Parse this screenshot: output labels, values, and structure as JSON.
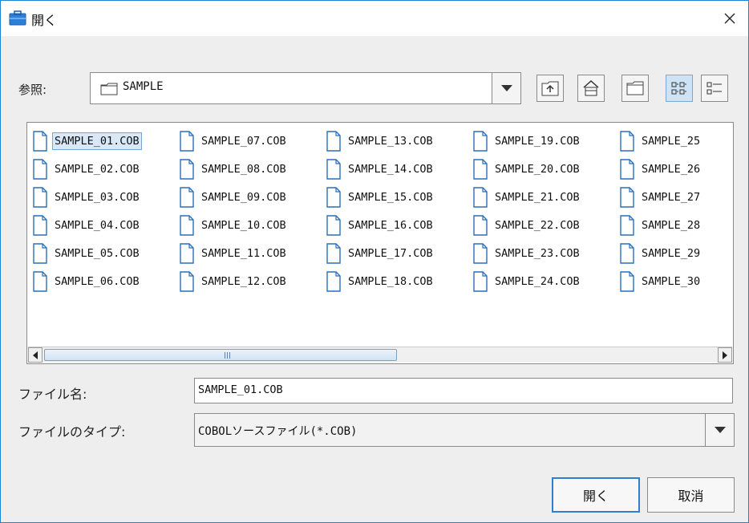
{
  "window": {
    "title": "開く",
    "close_glyph": "✕"
  },
  "lookin": {
    "label": "参照:",
    "value": "SAMPLE"
  },
  "toolbar": {
    "buttons": [
      {
        "icon": "up-one-level-icon"
      },
      {
        "icon": "home-icon"
      },
      {
        "icon": "new-folder-icon"
      },
      {
        "icon": "list-view-icon",
        "selected": true
      },
      {
        "icon": "details-view-icon"
      }
    ]
  },
  "files": [
    "SAMPLE_01.COB",
    "SAMPLE_02.COB",
    "SAMPLE_03.COB",
    "SAMPLE_04.COB",
    "SAMPLE_05.COB",
    "SAMPLE_06.COB",
    "SAMPLE_07.COB",
    "SAMPLE_08.COB",
    "SAMPLE_09.COB",
    "SAMPLE_10.COB",
    "SAMPLE_11.COB",
    "SAMPLE_12.COB",
    "SAMPLE_13.COB",
    "SAMPLE_14.COB",
    "SAMPLE_15.COB",
    "SAMPLE_16.COB",
    "SAMPLE_17.COB",
    "SAMPLE_18.COB",
    "SAMPLE_19.COB",
    "SAMPLE_20.COB",
    "SAMPLE_21.COB",
    "SAMPLE_22.COB",
    "SAMPLE_23.COB",
    "SAMPLE_24.COB",
    "SAMPLE_25",
    "SAMPLE_26",
    "SAMPLE_27",
    "SAMPLE_28",
    "SAMPLE_29",
    "SAMPLE_30"
  ],
  "selected_file_index": 0,
  "filename": {
    "label": "ファイル名:",
    "value": "SAMPLE_01.COB"
  },
  "filetype": {
    "label": "ファイルのタイプ:",
    "value": "COBOLソースファイル(*.COB)"
  },
  "buttons": {
    "open": "開く",
    "cancel": "取消"
  },
  "colors": {
    "accent": "#1883d7",
    "selection": "#d9e8f7",
    "default_border": "#2f7fd0"
  }
}
